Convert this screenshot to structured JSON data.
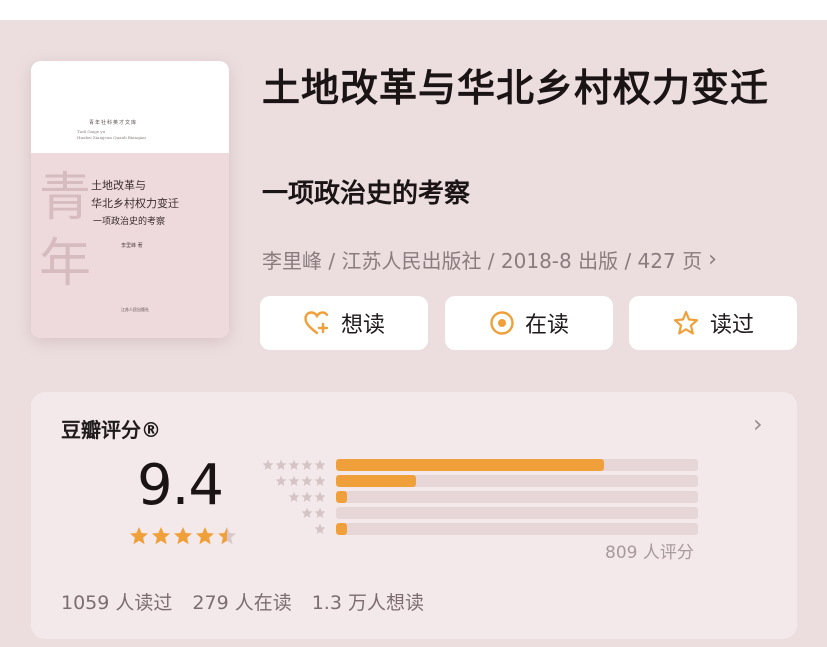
{
  "book": {
    "title": "土地改革与华北乡村权力变迁",
    "subtitle": "一项政治史的考察",
    "meta": "李里峰 / 江苏人民出版社 / 2018-8 出版 / 427 页"
  },
  "cover": {
    "series": "青年社科英才文库",
    "pinyin_line1": "Tudi Gaige yu",
    "pinyin_line2": "Huabei Xiangcun Quanli Bianqian",
    "brush_chars": "青年",
    "title_line1": "土地改革与",
    "title_line2": "华北乡村权力变迁",
    "subtitle": "一项政治史的考察",
    "author": "李里峰 著",
    "publisher": "江苏人民出版社"
  },
  "actions": {
    "want_label": "想读",
    "reading_label": "在读",
    "read_label": "读过"
  },
  "rating": {
    "label": "豆瓣评分®",
    "score": "9.4",
    "score_stars": 4.5,
    "distribution": [
      {
        "stars": 5,
        "fraction": 0.74
      },
      {
        "stars": 4,
        "fraction": 0.22
      },
      {
        "stars": 3,
        "fraction": 0.03
      },
      {
        "stars": 2,
        "fraction": 0.0
      },
      {
        "stars": 1,
        "fraction": 0.03
      }
    ],
    "count_text": "809 人评分"
  },
  "stats": {
    "read": "1059 人读过",
    "reading": "279 人在读",
    "want": "1.3 万人想读"
  },
  "colors": {
    "accent": "#f0a03a",
    "background": "#ecdedf",
    "card": "#f4e9ea"
  }
}
